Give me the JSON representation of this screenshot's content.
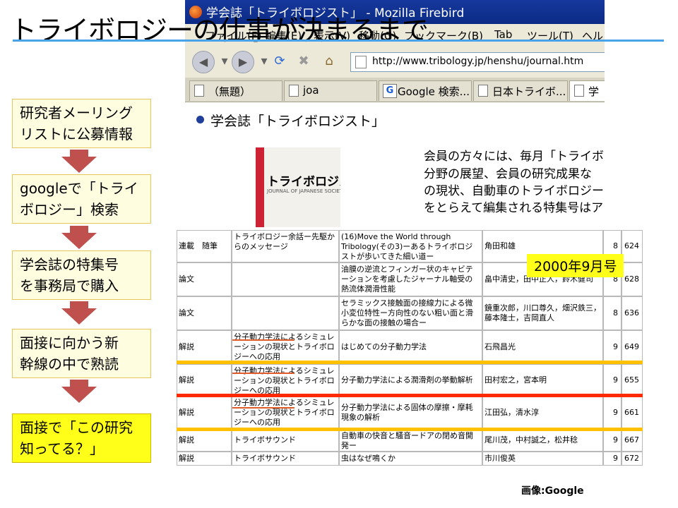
{
  "slide": {
    "title": "トライボロジーの仕事が決まるまで",
    "credit": "画像:Google",
    "year_badge": "2000年9月号"
  },
  "steps": [
    {
      "line1": "研究者メーリング",
      "line2": "リストに公募情報"
    },
    {
      "line1": "googleで「トライ",
      "line2": "ボロジー」検索"
    },
    {
      "line1": "学会誌の特集号",
      "line2": "を事務局で購入"
    },
    {
      "line1": "面接に向かう新",
      "line2": "幹線の中で熟読"
    },
    {
      "line1": "面接で「この研究",
      "line2": "知ってる？」"
    }
  ],
  "browser": {
    "window_title": "学会誌「トライボロジスト」 - Mozilla Firebird",
    "menu": [
      "ファイル(F)",
      "編集(E)",
      "表示(V)",
      "移動(G)",
      "ブックマーク(B)",
      "Tab",
      "ツール(T)",
      "ヘルプ"
    ],
    "url": "http://www.tribology.jp/henshu/journal.htm",
    "tabs": [
      "（無題）",
      "joa",
      "Google 検索...",
      "日本トライボ...",
      "学"
    ],
    "page_heading": "学会誌「トライボロジスト」",
    "journal_cover_title": "トライボロジスト",
    "journal_cover_subtitle": "JOURNAL OF JAPANESE SOCIETY OF TRIBOLOGISTS",
    "intro_lines": [
      "会員の方々には、毎月「トライボロ",
      "分野の展望、会員の研究成果な",
      "の現状、自動車のトライボロジー",
      "をとらえて編集される特集号はア"
    ]
  },
  "table": {
    "rows": [
      {
        "type": "連載　随筆",
        "series": "トライボロジー余話ー先駆からのメッセージ",
        "title": "(16)Move the World through Tribology(その3)ーあるトライボロジストが歩いてきた細い道ー",
        "authors": "角田和雄",
        "issue": "8",
        "page": "624"
      },
      {
        "type": "論文",
        "series": "",
        "title": "油膜の逆流とフィンガー状のキャビテーションを考慮したジャーナル軸受の熱流体潤滑性能",
        "authors": "畠中清史，田中正人，鈴木健司",
        "issue": "8",
        "page": "628"
      },
      {
        "type": "論文",
        "series": "",
        "title": "セラミックス接触面の接線力による微小変位特性ー方向性のない粗い面と滑らかな面の接触の場合ー",
        "authors": "鏡重次郎，川口尊久，畑沢鉄三，藤本隆士，吉岡直人",
        "issue": "8",
        "page": "636"
      },
      {
        "type": "解説",
        "series": "分子動力学法によるシミュレーションの現状とトライボロジーへの応用",
        "title": "はじめての分子動力学法",
        "authors": "石飛昌光",
        "issue": "9",
        "page": "649"
      },
      {
        "type": "解説",
        "series": "分子動力学法によるシミュレーションの現状とトライボロジーへの応用",
        "title": "分子動力学法による潤滑剤の挙動解析",
        "authors": "田村宏之，宮本明",
        "issue": "9",
        "page": "655"
      },
      {
        "type": "解説",
        "series": "分子動力学法によるシミュレーションの現状とトライボロジーへの応用",
        "title": "分子動力学法による固体の摩擦・摩耗現象の解析",
        "authors": "江田弘，清水淳",
        "issue": "9",
        "page": "661"
      },
      {
        "type": "解説",
        "series": "トライボサウンド",
        "title": "自動車の快音と騒音ードアの閉め音開発ー",
        "authors": "尾川茂，中村誠之，松井稔",
        "issue": "9",
        "page": "667"
      },
      {
        "type": "解説",
        "series": "トライボサウンド",
        "title": "虫はなぜ鳴くか",
        "authors": "市川俊英",
        "issue": "9",
        "page": "672"
      }
    ]
  },
  "colors": {
    "title_rule": "#4aa3e6",
    "step_box_fill": "#fffde0",
    "final_box_fill": "#ffff1a",
    "arrow": "#c0504d",
    "highlight_orange": "#ffc000",
    "highlight_red": "#ff2a00"
  }
}
